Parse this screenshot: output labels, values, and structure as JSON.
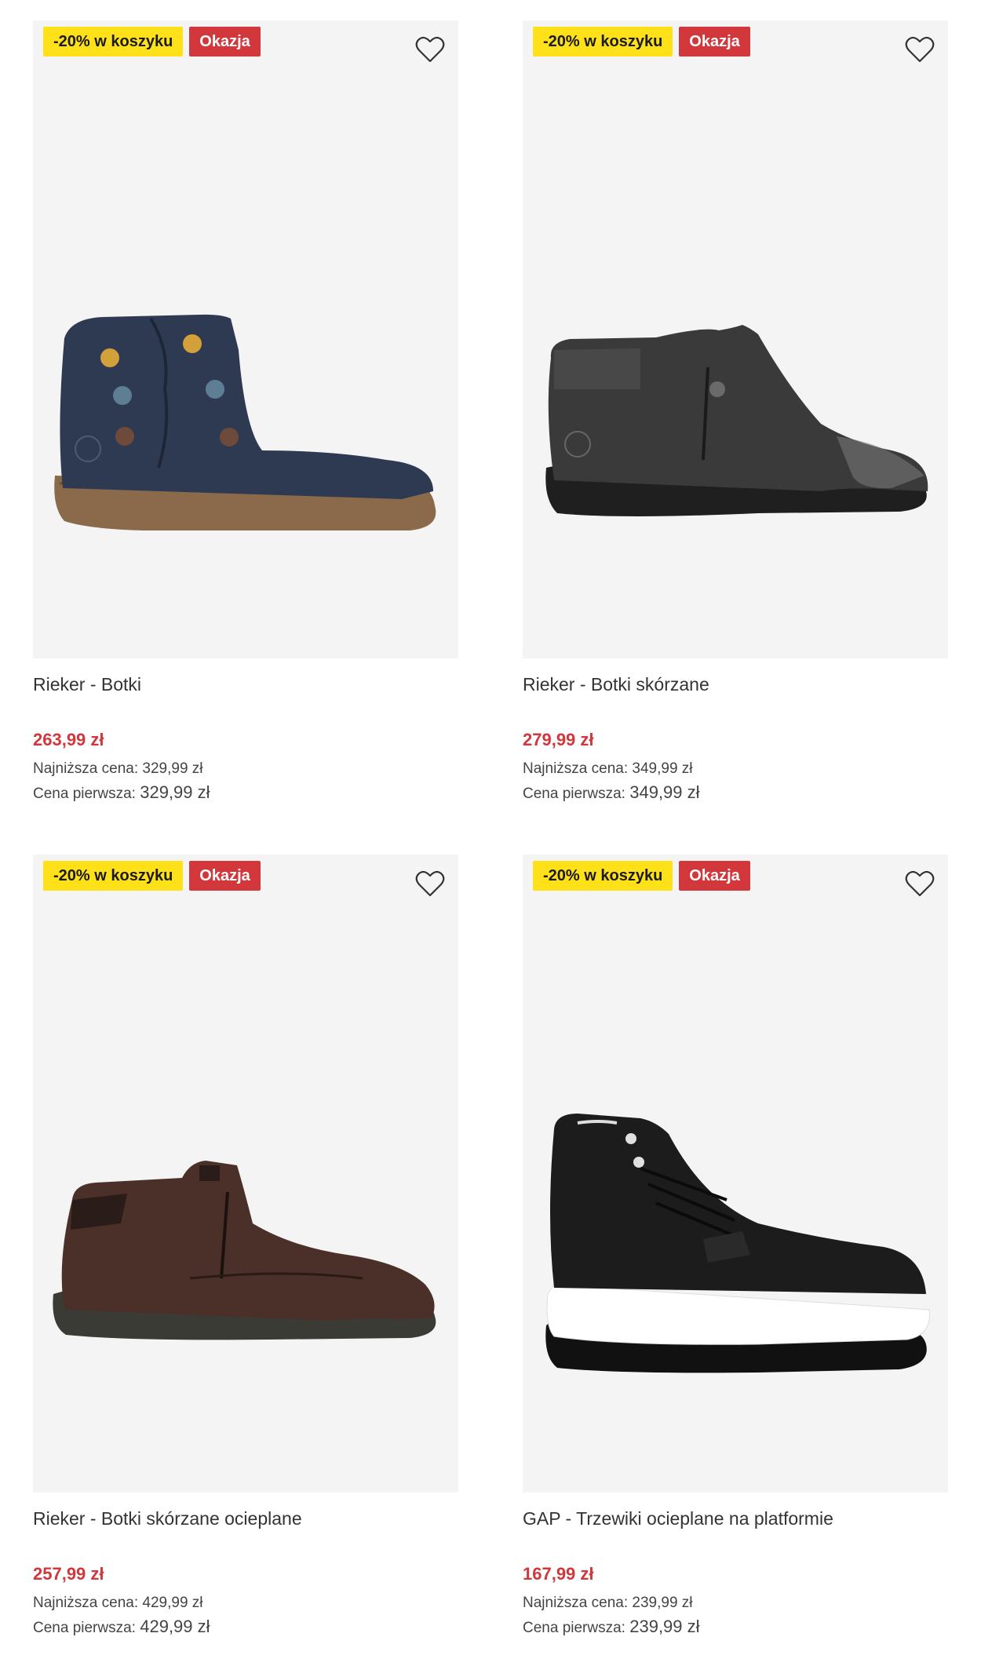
{
  "colors": {
    "sale_red": "#d2373b",
    "badge_yellow": "#ffe11a",
    "image_bg": "#f4f4f4"
  },
  "products": [
    {
      "badges": {
        "discount": "-20% w koszyku",
        "deal": "Okazja"
      },
      "favorite_icon": "heart-outline-icon",
      "name": "Rieker - Botki",
      "price": "263,99 zł",
      "lowest_label": "Najniższa cena:",
      "lowest_value": "329,99 zł",
      "original_label": "Cena pierwsza:",
      "original_value": "329,99 zł"
    },
    {
      "badges": {
        "discount": "-20% w koszyku",
        "deal": "Okazja"
      },
      "favorite_icon": "heart-outline-icon",
      "name": "Rieker - Botki skórzane",
      "price": "279,99 zł",
      "lowest_label": "Najniższa cena:",
      "lowest_value": "349,99 zł",
      "original_label": "Cena pierwsza:",
      "original_value": "349,99 zł"
    },
    {
      "badges": {
        "discount": "-20% w koszyku",
        "deal": "Okazja"
      },
      "favorite_icon": "heart-outline-icon",
      "name": "Rieker - Botki skórzane ocieplane",
      "price": "257,99 zł",
      "lowest_label": "Najniższa cena:",
      "lowest_value": "429,99 zł",
      "original_label": "Cena pierwsza:",
      "original_value": "429,99 zł"
    },
    {
      "badges": {
        "discount": "-20% w koszyku",
        "deal": "Okazja"
      },
      "favorite_icon": "heart-outline-icon",
      "name": "GAP - Trzewiki ocieplane na platformie",
      "price": "167,99 zł",
      "lowest_label": "Najniższa cena:",
      "lowest_value": "239,99 zł",
      "original_label": "Cena pierwsza:",
      "original_value": "239,99 zł"
    }
  ]
}
